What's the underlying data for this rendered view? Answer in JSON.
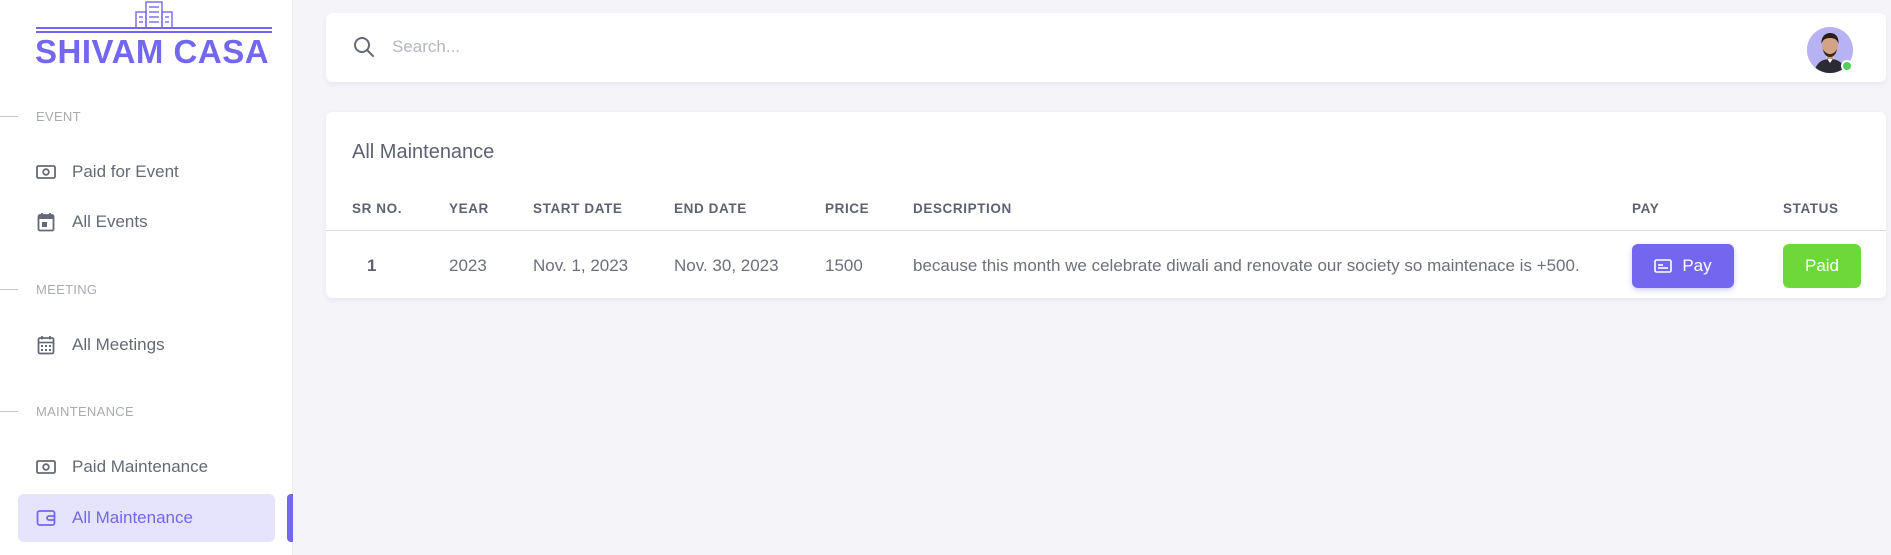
{
  "brand": {
    "name": "SHIVAM CASA",
    "color": "#7367f0"
  },
  "sidebar": {
    "sections": [
      {
        "header": "EVENT",
        "items": [
          {
            "label": "Paid for Event",
            "icon": "cash-icon"
          },
          {
            "label": "All Events",
            "icon": "calendar-icon"
          }
        ]
      },
      {
        "header": "MEETING",
        "items": [
          {
            "label": "All Meetings",
            "icon": "calendar-grid-icon"
          }
        ]
      },
      {
        "header": "MAINTENANCE",
        "items": [
          {
            "label": "Paid Maintenance",
            "icon": "cash-icon"
          },
          {
            "label": "All Maintenance",
            "icon": "wallet-icon",
            "active": true
          }
        ]
      }
    ]
  },
  "topbar": {
    "search": {
      "placeholder": "Search...",
      "value": ""
    },
    "user": {
      "online": true
    }
  },
  "maintenance": {
    "title": "All Maintenance",
    "columns": [
      "SR NO.",
      "YEAR",
      "START DATE",
      "END DATE",
      "PRICE",
      "DESCRIPTION",
      "PAY",
      "STATUS"
    ],
    "rows": [
      {
        "sr_no": "1",
        "year": "2023",
        "start_date": "Nov. 1, 2023",
        "end_date": "Nov. 30, 2023",
        "price": "1500",
        "description": "because this month we celebrate diwali and renovate our society so maintenace is +500.",
        "pay_label": "Pay",
        "status": "Paid"
      }
    ]
  },
  "colors": {
    "accent": "#7367f0",
    "active_bg": "#e6e4fc",
    "paid_green": "#6ed83a",
    "online_green": "#4fd15c",
    "page_bg": "#f4f4f9"
  }
}
